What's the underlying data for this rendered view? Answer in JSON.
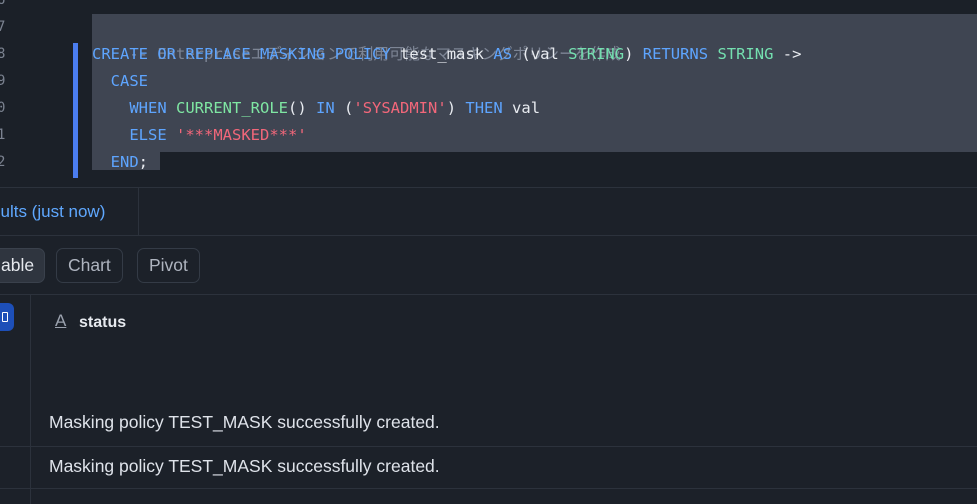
{
  "editor": {
    "line_numbers": [
      "6",
      "7",
      "8",
      "9",
      "0",
      "1",
      "2"
    ],
    "comment": "-- Enterpriseエディションで利用可能なマスキングポリシーを作成",
    "code": {
      "l8_create": "CREATE",
      "l8_or": "OR",
      "l8_replace": "REPLACE",
      "l8_masking": "MASKING",
      "l8_policy": "POLICY",
      "l8_name": "test_mask",
      "l8_as": "AS",
      "l8_open": "(val",
      "l8_type1": "STRING",
      "l8_close": ")",
      "l8_returns": "RETURNS",
      "l8_type2": "STRING",
      "l8_arrow": "->",
      "l9_case": "CASE",
      "l10_when": "WHEN",
      "l10_fn": "CURRENT_ROLE",
      "l10_parens": "()",
      "l10_in": "IN",
      "l10_po": "(",
      "l10_str": "'SYSADMIN'",
      "l10_pc": ")",
      "l10_then": "THEN",
      "l10_val": "val",
      "l11_else": "ELSE",
      "l11_str": "'***MASKED***'",
      "l12_end": "END",
      "l12_semi": ";"
    }
  },
  "results": {
    "tab_label": "sults (just now)",
    "views": [
      "able",
      "Chart",
      "Pivot"
    ],
    "column": {
      "type_icon": "A",
      "name": "status"
    },
    "rows": [
      "Masking policy TEST_MASK successfully created.",
      "Masking policy TEST_MASK successfully created."
    ]
  },
  "colors": {
    "accent": "#5fa8ff",
    "keyword": "#5ea5ff",
    "type": "#74e0b0",
    "string": "#f2677a",
    "comment": "#7d8595"
  }
}
